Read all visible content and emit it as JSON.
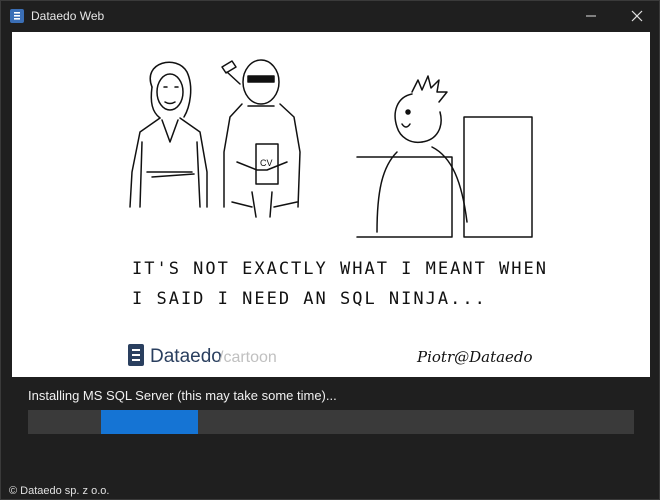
{
  "window": {
    "title": "Dataedo Web",
    "icon": "dataedo-logo-icon",
    "colors": {
      "background": "#1f1f1f",
      "accent": "#1574d4",
      "track": "#3a3a3a"
    }
  },
  "cartoon": {
    "caption_line1": "IT'S NOT EXACTLY WHAT I MEANT WHEN",
    "caption_line2": "I SAID I NEED AN SQL NINJA...",
    "cv_label": "CV",
    "brand_name": "Dataedo",
    "brand_sub": "/cartoon",
    "signature": "Piotr@Dataedo"
  },
  "installer": {
    "status_text": "Installing MS SQL Server (this may take some time)...",
    "progress": {
      "state": "indeterminate",
      "segment_start_fraction": 0.12,
      "segment_end_fraction": 0.28
    }
  },
  "footer": {
    "copyright": "© Dataedo sp. z o.o."
  }
}
